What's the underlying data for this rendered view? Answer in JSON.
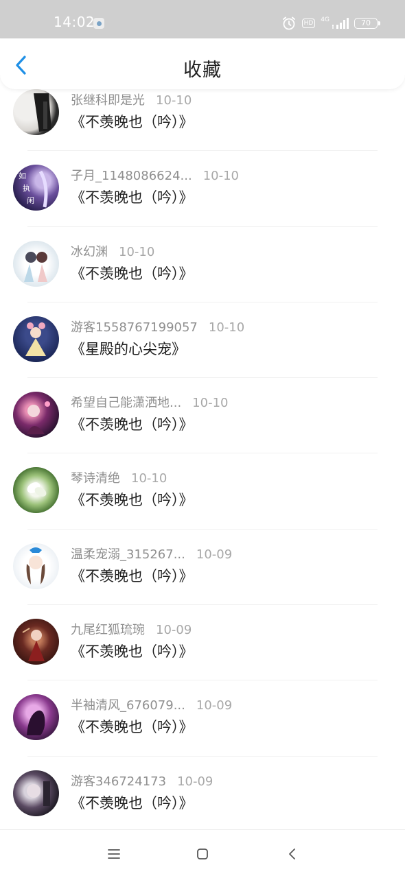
{
  "status": {
    "time": "14:02",
    "hd": "HD",
    "network": "4G",
    "battery": "70"
  },
  "header": {
    "title": "收藏"
  },
  "items": [
    {
      "name": "张继科即是光",
      "date": "10-10",
      "book": "《不羡晚也（吟）》"
    },
    {
      "name": "子月_1148086624...",
      "date": "10-10",
      "book": "《不羡晚也（吟）》"
    },
    {
      "name": "冰幻渊",
      "date": "10-10",
      "book": "《不羡晚也（吟）》"
    },
    {
      "name": "游客1558767199057",
      "date": "10-10",
      "book": "《星殿的心尖宠》"
    },
    {
      "name": "希望自己能潇洒地...",
      "date": "10-10",
      "book": "《不羡晚也（吟）》"
    },
    {
      "name": "琴诗清绝",
      "date": "10-10",
      "book": "《不羡晚也（吟）》"
    },
    {
      "name": "温柔宠溺_315267...",
      "date": "10-09",
      "book": "《不羡晚也（吟）》"
    },
    {
      "name": "九尾红狐琉琬",
      "date": "10-09",
      "book": "《不羡晚也（吟）》"
    },
    {
      "name": "半袖清风_676079...",
      "date": "10-09",
      "book": "《不羡晚也（吟）》"
    },
    {
      "name": "游客346724173",
      "date": "10-09",
      "book": "《不羡晚也（吟）》"
    }
  ],
  "icons": {
    "back": "chevron-left-icon",
    "menu": "menu-icon",
    "home": "home-square-icon",
    "nav_back": "nav-back-icon"
  },
  "colors": {
    "accent": "#1e8fe6",
    "status_bar": "#cfcfcf"
  }
}
